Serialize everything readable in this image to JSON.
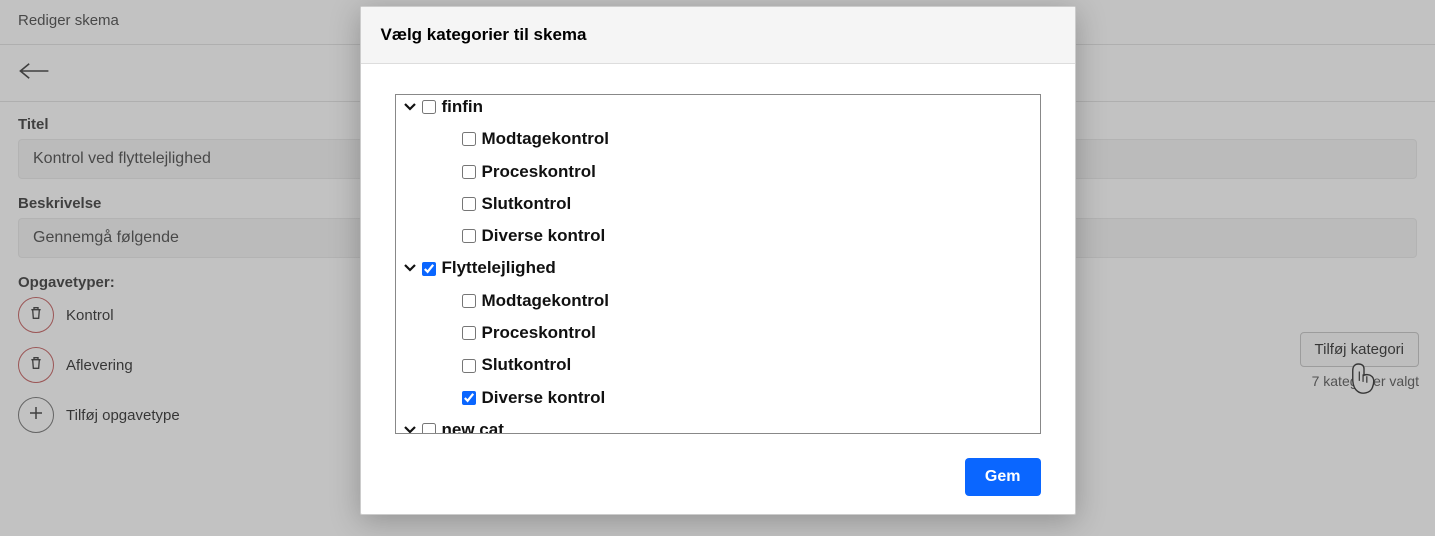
{
  "page": {
    "header": "Rediger skema",
    "title_label": "Titel",
    "title_value": "Kontrol ved flyttelejlighed",
    "desc_label": "Beskrivelse",
    "desc_value": "Gennemgå følgende",
    "tasks_label": "Opgavetyper:",
    "tasks": [
      "Kontrol",
      "Aflevering"
    ],
    "add_task": "Tilføj opgavetype",
    "add_category_btn": "Tilføj kategori",
    "category_count": "7 kategorier valgt"
  },
  "modal": {
    "title": "Vælg kategorier til skema",
    "save": "Gem",
    "tree": [
      {
        "level": 0,
        "expandable": true,
        "checked": false,
        "label": "finfin"
      },
      {
        "level": 1,
        "expandable": false,
        "checked": false,
        "label": "Modtagekontrol"
      },
      {
        "level": 1,
        "expandable": false,
        "checked": false,
        "label": "Proceskontrol"
      },
      {
        "level": 1,
        "expandable": false,
        "checked": false,
        "label": "Slutkontrol"
      },
      {
        "level": 1,
        "expandable": false,
        "checked": false,
        "label": "Diverse kontrol"
      },
      {
        "level": 0,
        "expandable": true,
        "checked": true,
        "label": "Flyttelejlighed"
      },
      {
        "level": 1,
        "expandable": false,
        "checked": false,
        "label": "Modtagekontrol"
      },
      {
        "level": 1,
        "expandable": false,
        "checked": false,
        "label": "Proceskontrol"
      },
      {
        "level": 1,
        "expandable": false,
        "checked": false,
        "label": "Slutkontrol"
      },
      {
        "level": 1,
        "expandable": false,
        "checked": true,
        "label": "Diverse kontrol"
      },
      {
        "level": 0,
        "expandable": true,
        "checked": false,
        "label": "new cat"
      }
    ]
  }
}
